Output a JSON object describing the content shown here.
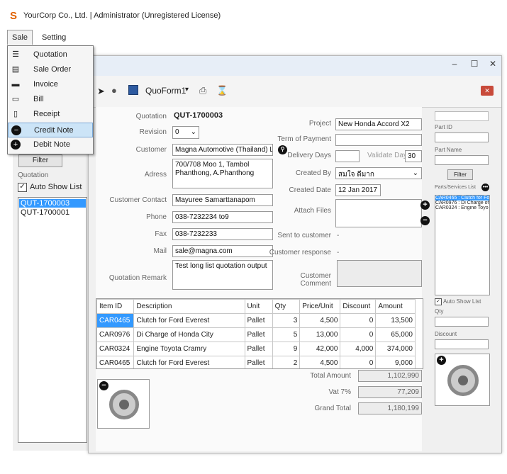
{
  "app": {
    "logo": "S",
    "title": "YourCorp Co., Ltd. | Administrator (Unregistered License)"
  },
  "menubar": {
    "sale": "Sale",
    "setting": "Setting"
  },
  "sale_menu": {
    "items": [
      {
        "label": "Quotation",
        "icon": "quotation-icon",
        "glyph": "☰"
      },
      {
        "label": "Sale Order",
        "icon": "sale-order-icon",
        "glyph": "▤"
      },
      {
        "label": "Invoice",
        "icon": "invoice-icon",
        "glyph": "▬"
      },
      {
        "label": "Bill",
        "icon": "bill-icon",
        "glyph": "▭"
      },
      {
        "label": "Receipt",
        "icon": "receipt-icon",
        "glyph": "▯"
      },
      {
        "label": "Credit Note",
        "icon": "minus-circle-icon",
        "glyph": "−"
      },
      {
        "label": "Debit Note",
        "icon": "plus-circle-icon",
        "glyph": "+"
      }
    ],
    "selected_index": 5
  },
  "window": {
    "minimize": "–",
    "maximize": "☐",
    "close": "✕"
  },
  "toolbar": {
    "form_name": "QuoForm1",
    "dropdown_arrow": "▾",
    "close_glyph": "✕"
  },
  "left_panel": {
    "filter_button": "Filter",
    "section_label": "Quotation",
    "auto_show_label": "Auto Show List",
    "auto_show_checked": true,
    "list": [
      "QUT-1700003",
      "QUT-1700001"
    ],
    "selected_index": 0
  },
  "form": {
    "quotation_label": "Quotation",
    "quotation_value": "QUT-1700003",
    "revision_label": "Revision",
    "revision_value": "0",
    "customer_label": "Customer",
    "customer_value": "Magna Automotive (Thailand) Ltd.",
    "address_label": "Adress",
    "address_value": "700/708 Moo 1, Tambol Phanthong, A.Phanthong",
    "contact_label": "Customer Contact",
    "contact_value": "Mayuree Samarttanapom",
    "phone_label": "Phone",
    "phone_value": "038-7232234 to9",
    "fax_label": "Fax",
    "fax_value": "038-7232233",
    "mail_label": "Mail",
    "mail_value": "sale@magna.com",
    "remark_label": "Quotation Remark",
    "remark_value": "Test long list quotation output",
    "project_label": "Project",
    "project_value": "New Honda Accord X2",
    "term_label": "Term of Payment",
    "term_value": "",
    "delivery_label": "Delivery Days",
    "delivery_value": "",
    "validate_label": "Validate Days",
    "validate_value": "30",
    "createdby_label": "Created By",
    "createdby_value": "สมใจ ดีมาก",
    "createddate_label": "Created Date",
    "createddate_value": "12 Jan  2017",
    "attach_label": "Attach Files",
    "sent_label": "Sent to customer",
    "sent_value": "-",
    "response_label": "Customer response",
    "response_value": "-",
    "comment_label": "Customer Comment"
  },
  "items_table": {
    "headers": [
      "Item ID",
      "Description",
      "Unit",
      "Qty",
      "Price/Unit",
      "Discount",
      "Amount"
    ],
    "rows": [
      {
        "id": "CAR0465",
        "desc": "Clutch for Ford Everest",
        "unit": "Pallet",
        "qty": "3",
        "price": "4,500",
        "disc": "0",
        "amount": "13,500"
      },
      {
        "id": "CAR0976",
        "desc": "Di Charge of Honda City",
        "unit": "Pallet",
        "qty": "5",
        "price": "13,000",
        "disc": "0",
        "amount": "65,000"
      },
      {
        "id": "CAR0324",
        "desc": "Engine Toyota Cramry",
        "unit": "Pallet",
        "qty": "9",
        "price": "42,000",
        "disc": "4,000",
        "amount": "374,000"
      },
      {
        "id": "CAR0465",
        "desc": "Clutch for Ford Everest",
        "unit": "Pallet",
        "qty": "2",
        "price": "4,500",
        "disc": "0",
        "amount": "9,000"
      }
    ]
  },
  "totals": {
    "total_label": "Total Amount",
    "total_value": "1,102,990",
    "vat_label": "Vat 7%",
    "vat_value": "77,209",
    "grand_label": "Grand Total",
    "grand_value": "1,180,199"
  },
  "right_panel": {
    "partid_label": "Part ID",
    "partname_label": "Part Name",
    "filter_button": "Filter",
    "list_label": "Parts/Services List",
    "list": [
      "CAR0465 : Clutch for Fo",
      "CAR0976 : Di Charge of",
      "CAR0324 : Engine Toyo"
    ],
    "selected_index": 0,
    "auto_show_label": "Auto Show List",
    "auto_show_checked": true,
    "qty_label": "Qty",
    "discount_label": "Discount"
  },
  "colors": {
    "accent": "#3399ff",
    "selection": "#cce4f7",
    "logo": "#e06000"
  }
}
